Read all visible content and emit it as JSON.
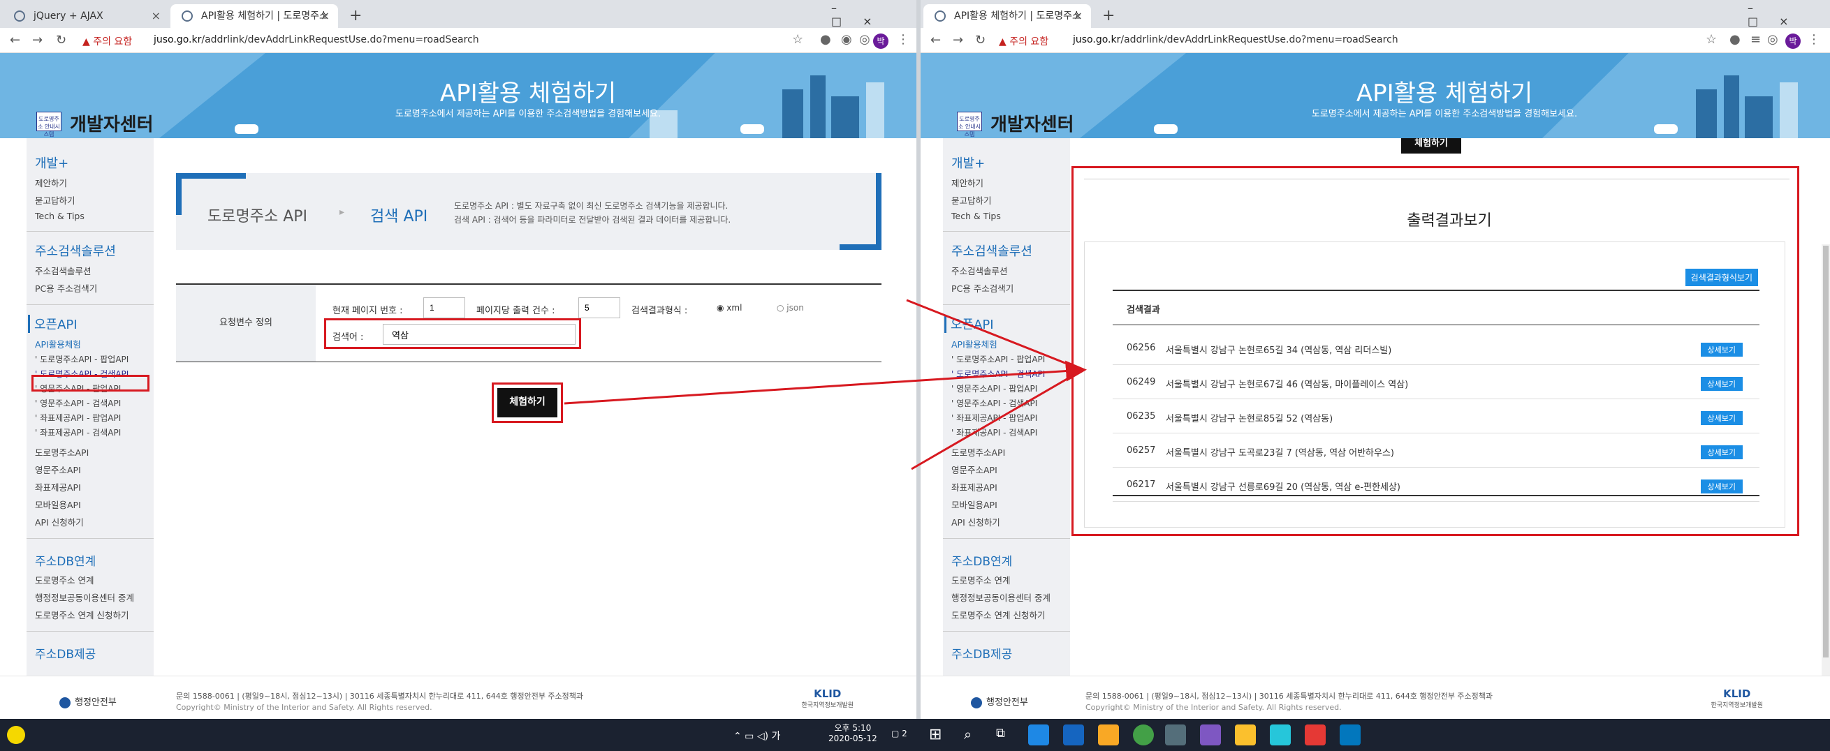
{
  "left": {
    "tabs": [
      {
        "label": "jQuery + AJAX"
      },
      {
        "label": "API활용 체험하기 | 도로명주소"
      }
    ],
    "nav_warning": "주의 요함",
    "url_host": "juso.go.kr",
    "url_path": "/addrlink/devAddrLinkRequestUse.do?menu=roadSearch",
    "avatar": "박",
    "banner": {
      "title": "API활용 체험하기",
      "subtitle": "도로명주소에서 제공하는 API를 이용한 주소검색방법을 경험해보세요.",
      "logo_text": "개발자센터",
      "logo_small": "도로명주소 안내시스템"
    },
    "sidebar": {
      "h_dev": "개발+",
      "dev_items": [
        "제안하기",
        "묻고답하기",
        "Tech & Tips"
      ],
      "h_solution": "주소검색솔루션",
      "solution_items": [
        "주소검색솔루션",
        "PC용 주소검색기"
      ],
      "h_openapi": "오픈API",
      "api_exp": "API활용체험",
      "api_sub": [
        "' 도로명주소API - 팝업API",
        "' 도로명주소API - 검색API",
        "' 영문주소API - 팝업API",
        "' 영문주소API - 검색API",
        "' 좌표제공API - 팝업API",
        "' 좌표제공API - 검색API"
      ],
      "api_items": [
        "도로명주소API",
        "영문주소API",
        "좌표제공API",
        "모바일용API",
        "API 신청하기"
      ],
      "h_db": "주소DB연계",
      "db_items": [
        "도로명주소 연계",
        "행정정보공동이용센터 중계",
        "도로명주소 연계 신청하기"
      ],
      "h_dbprov": "주소DB제공"
    },
    "api_header": {
      "crumb1": "도로명주소 API",
      "crumb2": "검색 API",
      "desc1": "도로명주소 API : 별도 자료구축 없이 최신 도로명주소 검색기능을 제공합니다.",
      "desc2": "검색 API : 검색어 등을 파라미터로 전달받아 검색된 결과 데이터를 제공합니다."
    },
    "form": {
      "label": "요청변수 정의",
      "page_label": "현재 페이지 번호 :",
      "page_value": "1",
      "count_label": "페이지당 출력 건수 :",
      "count_value": "5",
      "format_label": "검색결과형식 :",
      "opt_xml": "xml",
      "opt_json": "json",
      "keyword_label": "검색어 :",
      "keyword_value": "역삼"
    },
    "button": "체험하기",
    "footer": {
      "ministry": "행정안전부",
      "info": "문의 1588-0061 | (평일9~18시, 점심12~13시) | 30116 세종특별자치시 한누리대로 411, 644호 행정안전부 주소정책과",
      "copy": "Copyright© Ministry of the Interior and Safety. All Rights reserved.",
      "klid": "KLID",
      "klid_sub": "한국지역정보개발원"
    }
  },
  "right": {
    "tabs": [
      {
        "label": "API활용 체험하기 | 도로명주소"
      }
    ],
    "nav_warning": "주의 요함",
    "url_host": "juso.go.kr",
    "url_path": "/addrlink/devAddrLinkRequestUse.do?menu=roadSearch",
    "avatar": "박",
    "top_button": "체험하기",
    "result_title": "출력결과보기",
    "format_button": "검색결과형식보기",
    "results_header": "검색결과",
    "detail_label": "상세보기",
    "results": [
      {
        "zip": "06256",
        "addr": "서울특별시 강남구 논현로65길 34 (역삼동, 역삼 리더스빌)"
      },
      {
        "zip": "06249",
        "addr": "서울특별시 강남구 논현로67길 46 (역삼동, 마이플레이스 역삼)"
      },
      {
        "zip": "06235",
        "addr": "서울특별시 강남구 논현로85길 52 (역삼동)"
      },
      {
        "zip": "06257",
        "addr": "서울특별시 강남구 도곡로23길 7 (역삼동, 역삼 어반하우스)"
      },
      {
        "zip": "06217",
        "addr": "서울특별시 강남구 선릉로69길 20 (역삼동, 역삼 e-편한세상)"
      }
    ]
  },
  "taskbar": {
    "time": "오후 5:10",
    "date": "2020-05-12",
    "ime": "가",
    "notif": "2"
  },
  "colors": {
    "banner": "#4a9fd8",
    "accent": "#1f6fb8",
    "highlight": "#d71920"
  }
}
